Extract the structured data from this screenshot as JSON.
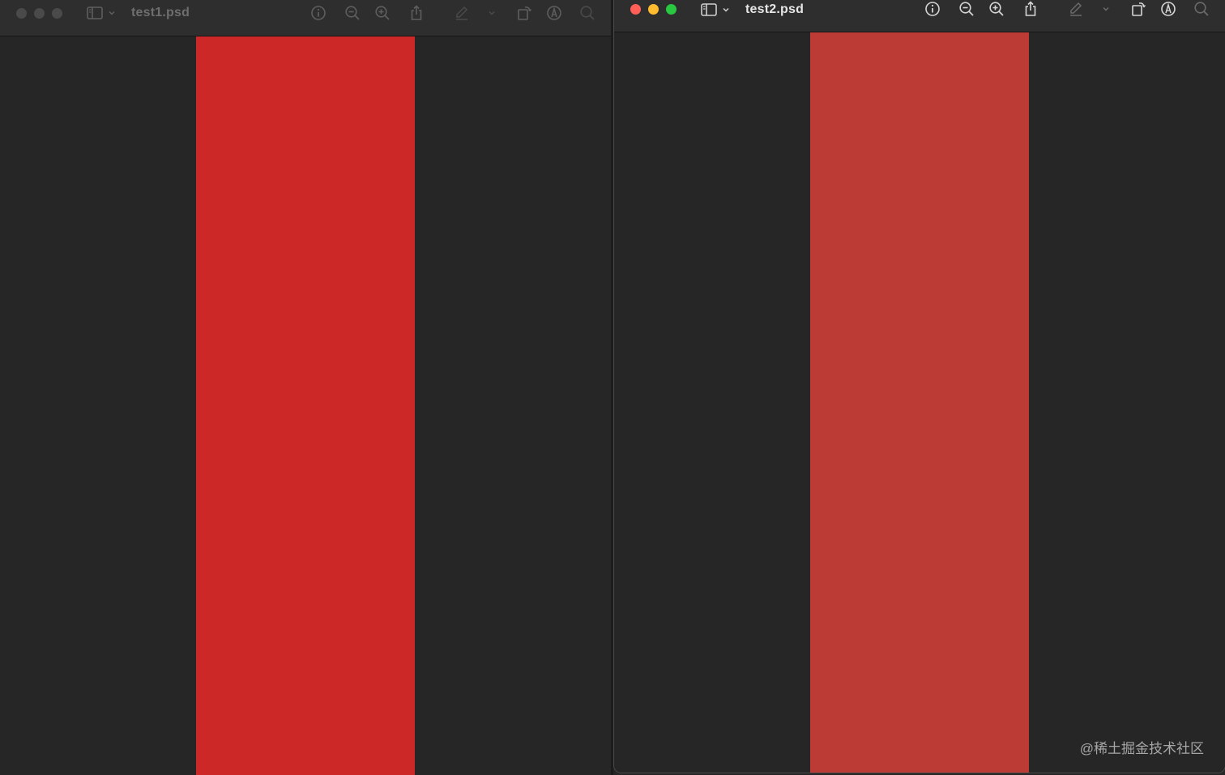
{
  "windows": [
    {
      "title": "test1.psd",
      "active": false,
      "stripe_color": "#cd2828",
      "light_colors": [
        "#4a4a4a",
        "#4a4a4a",
        "#4a4a4a"
      ]
    },
    {
      "title": "test2.psd",
      "active": true,
      "stripe_color": "#bc3c35",
      "light_colors": [
        "#ff5f57",
        "#febc2e",
        "#28c840"
      ]
    }
  ],
  "toolbar_icons": [
    "sidebar-icon",
    "chevron-down-icon",
    "info-icon",
    "zoom-out-icon",
    "zoom-in-icon",
    "share-icon",
    "highlight-pen-icon",
    "chevron-down-icon",
    "rotate-icon",
    "markup-icon",
    "search-icon"
  ],
  "watermark": "@稀土掘金技术社区"
}
